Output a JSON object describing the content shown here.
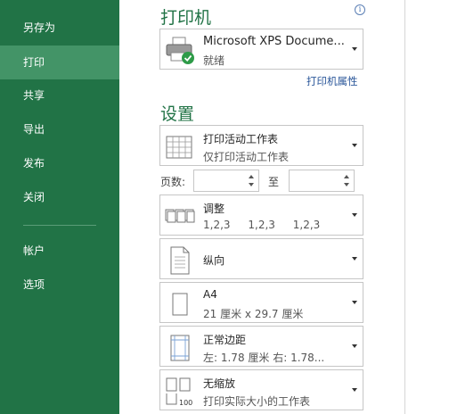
{
  "sidebar": {
    "items": [
      {
        "label": "另存为"
      },
      {
        "label": "打印"
      },
      {
        "label": "共享"
      },
      {
        "label": "导出"
      },
      {
        "label": "发布"
      },
      {
        "label": "关闭"
      },
      {
        "label": "帐户"
      },
      {
        "label": "选项"
      }
    ],
    "active_item": "打印"
  },
  "print": {
    "title": "打印机",
    "printer_name": "Microsoft XPS Docume...",
    "printer_status": "就绪",
    "printer_properties_link": "打印机属性"
  },
  "settings": {
    "title": "设置",
    "print_what": {
      "line1": "打印活动工作表",
      "line2": "仅打印活动工作表"
    },
    "pages_label": "页数:",
    "pages_from": "",
    "to_label": "至",
    "pages_to": "",
    "collation": {
      "line1": "调整",
      "seq1": "1,2,3",
      "seq2": "1,2,3",
      "seq3": "1,2,3"
    },
    "orientation": {
      "line1": "纵向"
    },
    "paper": {
      "line1": "A4",
      "line2": "21 厘米 x 29.7 厘米"
    },
    "margins": {
      "line1": "正常边距",
      "line2": "左: 1.78 厘米    右: 1.78..."
    },
    "scaling": {
      "line1": "无缩放",
      "line2": "打印实际大小的工作表"
    }
  },
  "colors": {
    "sidebar_bg": "#217346",
    "sidebar_active": "#439467",
    "accent_title": "#217346",
    "link": "#2b579a"
  }
}
